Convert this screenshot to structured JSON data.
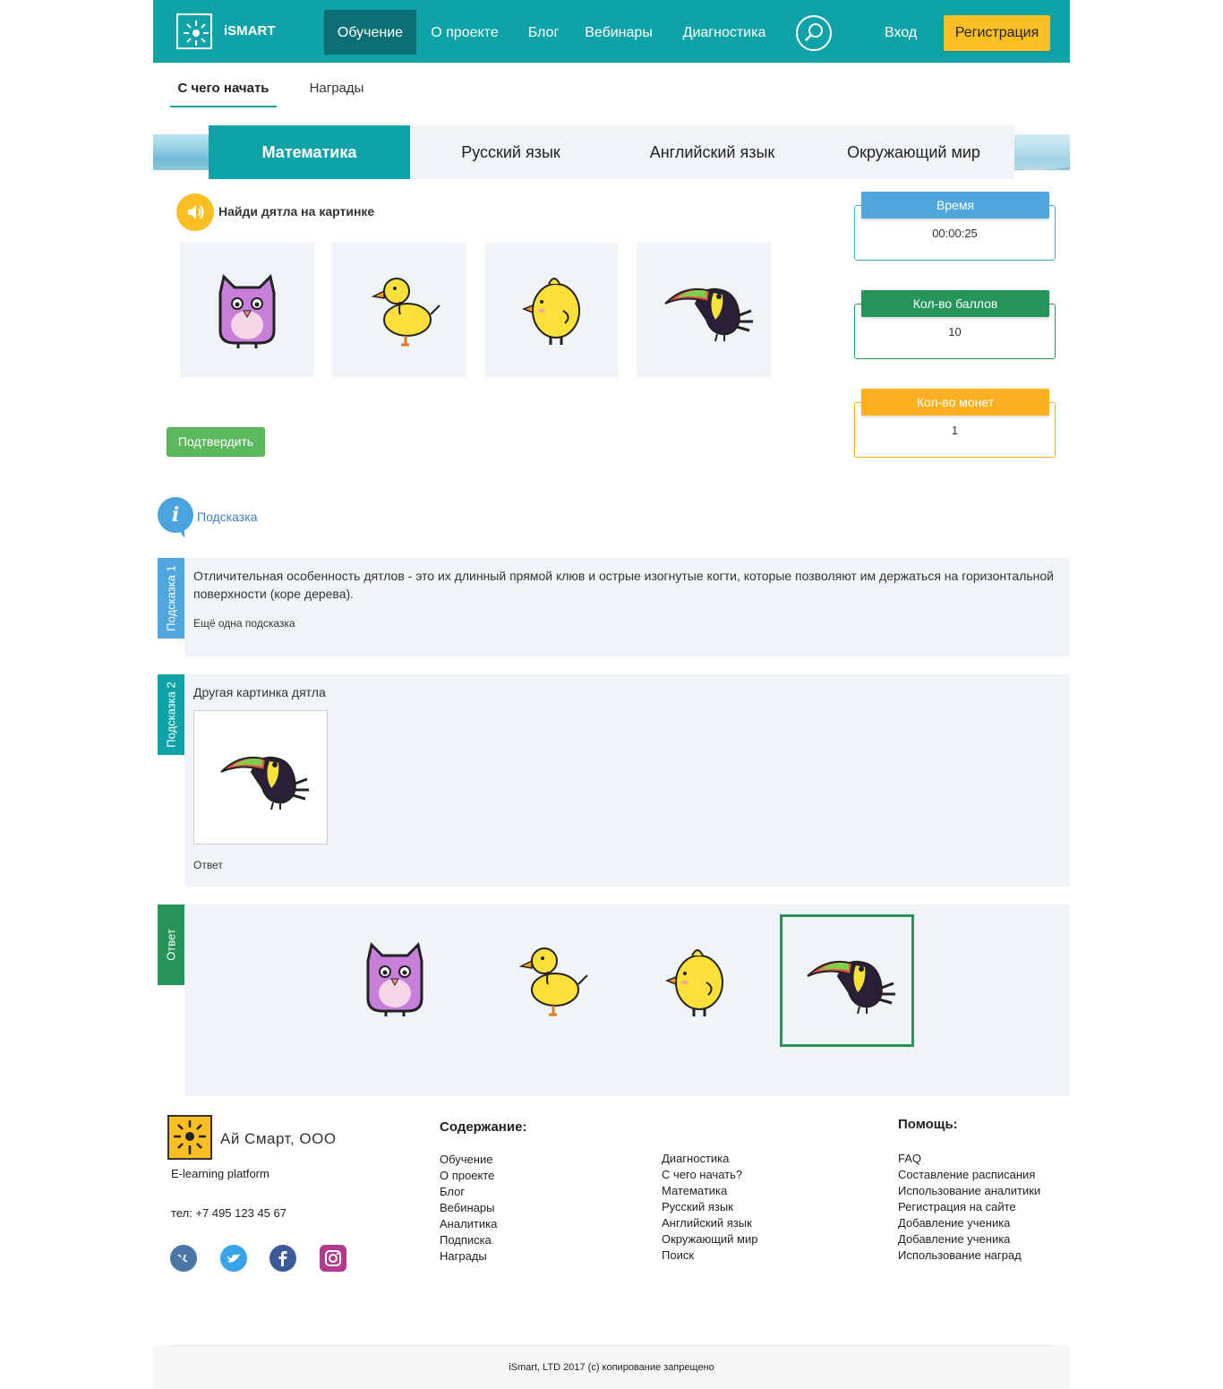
{
  "header": {
    "brand": "iSMART",
    "nav": [
      "Обучение",
      "О проекте",
      "Блог",
      "Вебинары",
      "Диагностика"
    ],
    "login": "Вход",
    "register": "Регистрация"
  },
  "subnav": {
    "tabs": [
      "С чего начать",
      "Награды"
    ]
  },
  "subjects": [
    "Математика",
    "Русский язык",
    "Английский язык",
    "Окружающий мир"
  ],
  "task": {
    "prompt": "Найди дятла на картинке",
    "options": [
      "owl",
      "duck",
      "chick",
      "toucan"
    ],
    "confirm": "Подтвердить"
  },
  "stats": {
    "time_label": "Время",
    "time_value": "00:00:25",
    "points_label": "Кол-во баллов",
    "points_value": "10",
    "coins_label": "Кол-во монет",
    "coins_value": "1",
    "colors": {
      "time": "#4ea6dc",
      "points": "#249458",
      "coins": "#fbb021"
    }
  },
  "hint": {
    "link": "Подсказка",
    "hint1_label": "Подсказка 1",
    "hint1_text": "Отличительная особенность дятлов - это их длинный прямой клюв и острые изогнутые когти, которые позволяют им держаться на горизонтальной поверхности (коре дерева).",
    "hint1_more": "Ещё одна подсказка",
    "hint2_label": "Подсказка 2",
    "hint2_text": "Другая картинка дятла",
    "hint2_answer": "Ответ",
    "answer_label": "Ответ"
  },
  "footer": {
    "company": "Ай Смарт, ООО",
    "tagline": "E-learning platform",
    "phone": "тел: +7 495 123 45 67",
    "content_title": "Содержание:",
    "col1": [
      "Обучение",
      "О проекте",
      "Блог",
      "Вебинары",
      "Аналитика",
      "Подписка",
      "Награды"
    ],
    "col2": [
      "Диагностика",
      "С чего начать?",
      "Математика",
      "Русский язык",
      "Английский язык",
      "Окружающий мир",
      "Поиск"
    ],
    "help_title": "Помощь:",
    "help": [
      "FAQ",
      "Составление расписания",
      "Использование аналитики",
      "Регистрация на сайте",
      "Добавление ученика",
      "Добавление ученика",
      "Использование наград"
    ],
    "copyright": "iSmart, LTD 2017 (c) копирование запрещено"
  }
}
